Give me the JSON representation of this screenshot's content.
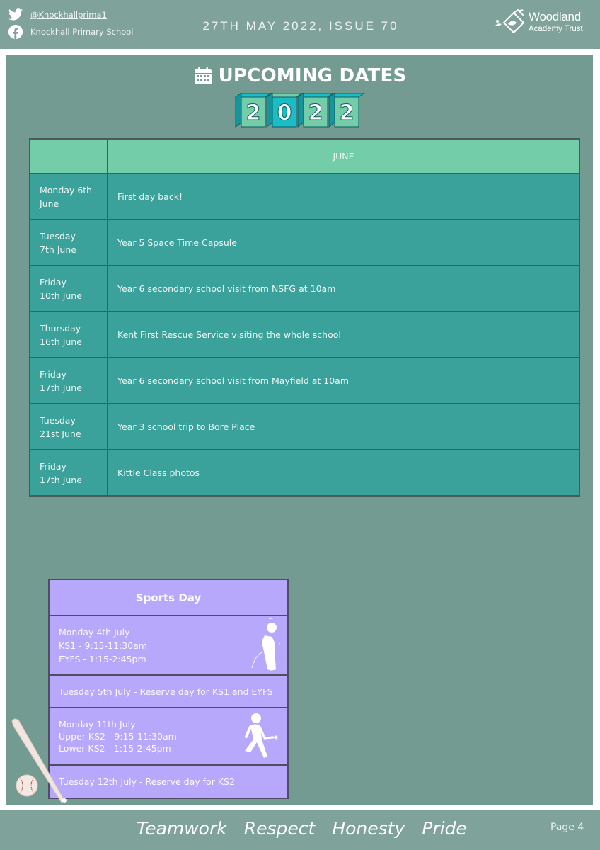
{
  "header": {
    "twitter_handle": "@Knockhallprima1",
    "facebook_name": "Knockhall Primary School",
    "issue_line": "27TH MAY 2022, ISSUE 70",
    "logo_line1": "Woodland",
    "logo_line2": "Academy Trust"
  },
  "main": {
    "title": "UPCOMING DATES",
    "title_icon": "calendar-icon",
    "year_digits": [
      "2",
      "0",
      "2",
      "2"
    ],
    "table": {
      "month_header": "JUNE",
      "rows": [
        {
          "date": "Monday 6th June",
          "date_line1": "Monday 6th",
          "date_line2": "June",
          "event": "First day back!"
        },
        {
          "date": "Tuesday 7th June",
          "date_line1": "Tuesday",
          "date_line2": "7th June",
          "event": "Year 5 Space Time Capsule"
        },
        {
          "date": "Friday 10th June",
          "date_line1": "Friday",
          "date_line2": "10th June",
          "event": "Year 6 secondary school visit from NSFG at 10am"
        },
        {
          "date": "Thursday 16th June",
          "date_line1": "Thursday",
          "date_line2": "16th June",
          "event": "Kent First Rescue Service visiting the whole school"
        },
        {
          "date": "Friday 17th June",
          "date_line1": "Friday",
          "date_line2": "17th June",
          "event": "Year 6 secondary school visit from Mayfield at 10am"
        },
        {
          "date": "Tuesday 21st June",
          "date_line1": "Tuesday",
          "date_line2": "21st June",
          "event": "Year 3 school trip to Bore Place"
        },
        {
          "date": "Friday 17th June",
          "date_line1": "Friday",
          "date_line2": "17th June",
          "event": "Kittle Class photos"
        }
      ]
    },
    "sports_day": {
      "title": "Sports Day",
      "ks1_block": [
        "Monday 4th July",
        "KS1 - 9:15-11:30am",
        "EYFS - 1:15-2:45pm"
      ],
      "ks1_reserve": "Tuesday 5th July - Reserve day for KS1 and EYFS",
      "ks2_block": [
        "Monday 11th July",
        "Upper KS2 - 9:15-11:30am",
        "Lower KS2 - 1:15-2:45pm"
      ],
      "ks2_reserve": "Tuesday 12th July - Reserve day for KS2"
    }
  },
  "footer": {
    "values": [
      "Teamwork",
      "Respect",
      "Honesty",
      "Pride"
    ],
    "page": "Page 4"
  },
  "colors": {
    "header_bg": "#7fa39a",
    "panel_bg": "#749b92",
    "table_header_bg": "#72cda8",
    "table_row_bg": "#3aa29a",
    "sports_bg": "#b8a8fb"
  }
}
